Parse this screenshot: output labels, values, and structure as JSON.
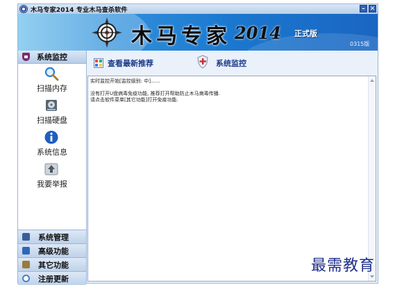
{
  "window": {
    "title": "木马专家2014 专业木马查杀软件"
  },
  "banner": {
    "brand": "木马专家",
    "year": "2014",
    "edition": "正式版",
    "version": "0315版"
  },
  "sidebar": {
    "header": "系统监控",
    "items": [
      {
        "label": "扫描内存",
        "icon": "magnifier-icon"
      },
      {
        "label": "扫描硬盘",
        "icon": "disk-icon"
      },
      {
        "label": "系统信息",
        "icon": "info-icon"
      },
      {
        "label": "我要举报",
        "icon": "report-icon"
      }
    ],
    "bottom": [
      {
        "label": "系统管理",
        "icon": "system-manage-icon",
        "color": "#3a5d9a"
      },
      {
        "label": "高级功能",
        "icon": "advanced-icon",
        "color": "#2f66b8"
      },
      {
        "label": "其它功能",
        "icon": "other-icon",
        "color": "#9b7b3a"
      },
      {
        "label": "注册更新",
        "icon": "register-icon",
        "color": "#4b7fc6"
      }
    ]
  },
  "toolbar": {
    "recommend_label": "查看最新推荐",
    "monitor_label": "系统监控"
  },
  "log": {
    "text": "实时监控开始[监控级别: 中]......\n\n没有打开U盘病毒免疫功能, 推荐打开帮助防止木马病毒传播.\n请点击软件菜单[其它功能]打开免疫功能."
  },
  "watermark": "最需教育"
}
